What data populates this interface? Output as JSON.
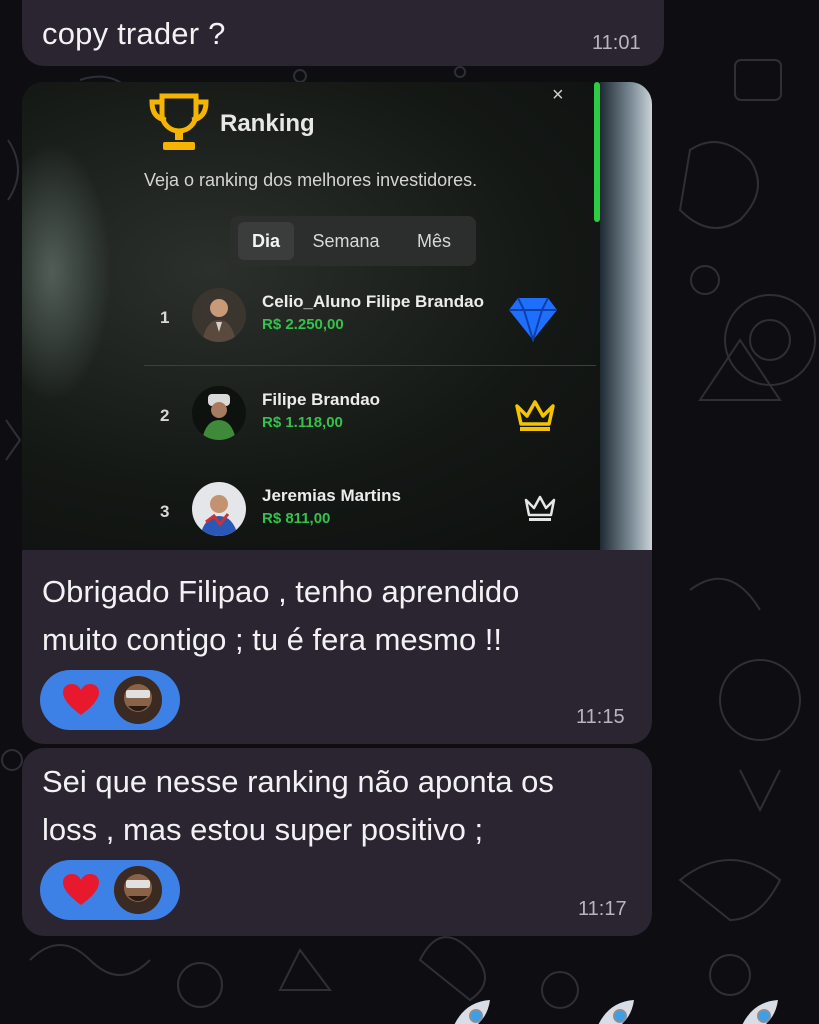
{
  "messages": [
    {
      "text": "copy trader ?",
      "time": "11:01"
    },
    {
      "text_lines": [
        "Obrigado Filipao , tenho aprendido",
        "muito contigo ; tu é fera mesmo !!"
      ],
      "time": "11:15",
      "reaction": {
        "emoji": "heart-icon"
      }
    },
    {
      "text_lines": [
        "Sei que nesse ranking não aponta os",
        "loss , mas estou super positivo ;"
      ],
      "time": "11:17",
      "reaction": {
        "emoji": "heart-icon"
      }
    }
  ],
  "ranking": {
    "title": "Ranking",
    "subtitle": "Veja o ranking dos melhores investidores.",
    "close": "×",
    "tabs": [
      "Dia",
      "Semana",
      "Mês"
    ],
    "active_tab": "Dia",
    "entries": [
      {
        "rank": "1",
        "name": "Celio_Aluno Filipe Brandao",
        "amount": "R$ 2.250,00",
        "badge": "diamond-icon"
      },
      {
        "rank": "2",
        "name": "Filipe Brandao",
        "amount": "R$ 1.118,00",
        "badge": "crown-gold-icon"
      },
      {
        "rank": "3",
        "name": "Jeremias Martins",
        "amount": "R$ 811,00",
        "badge": "crown-outline-icon"
      }
    ]
  },
  "colors": {
    "background": "#0d0d12",
    "bubble": "#2a2530",
    "reaction": "#3d80e6",
    "amount_green": "#35c24a",
    "trophy_gold": "#f5b400",
    "diamond_blue": "#1f6fff"
  }
}
